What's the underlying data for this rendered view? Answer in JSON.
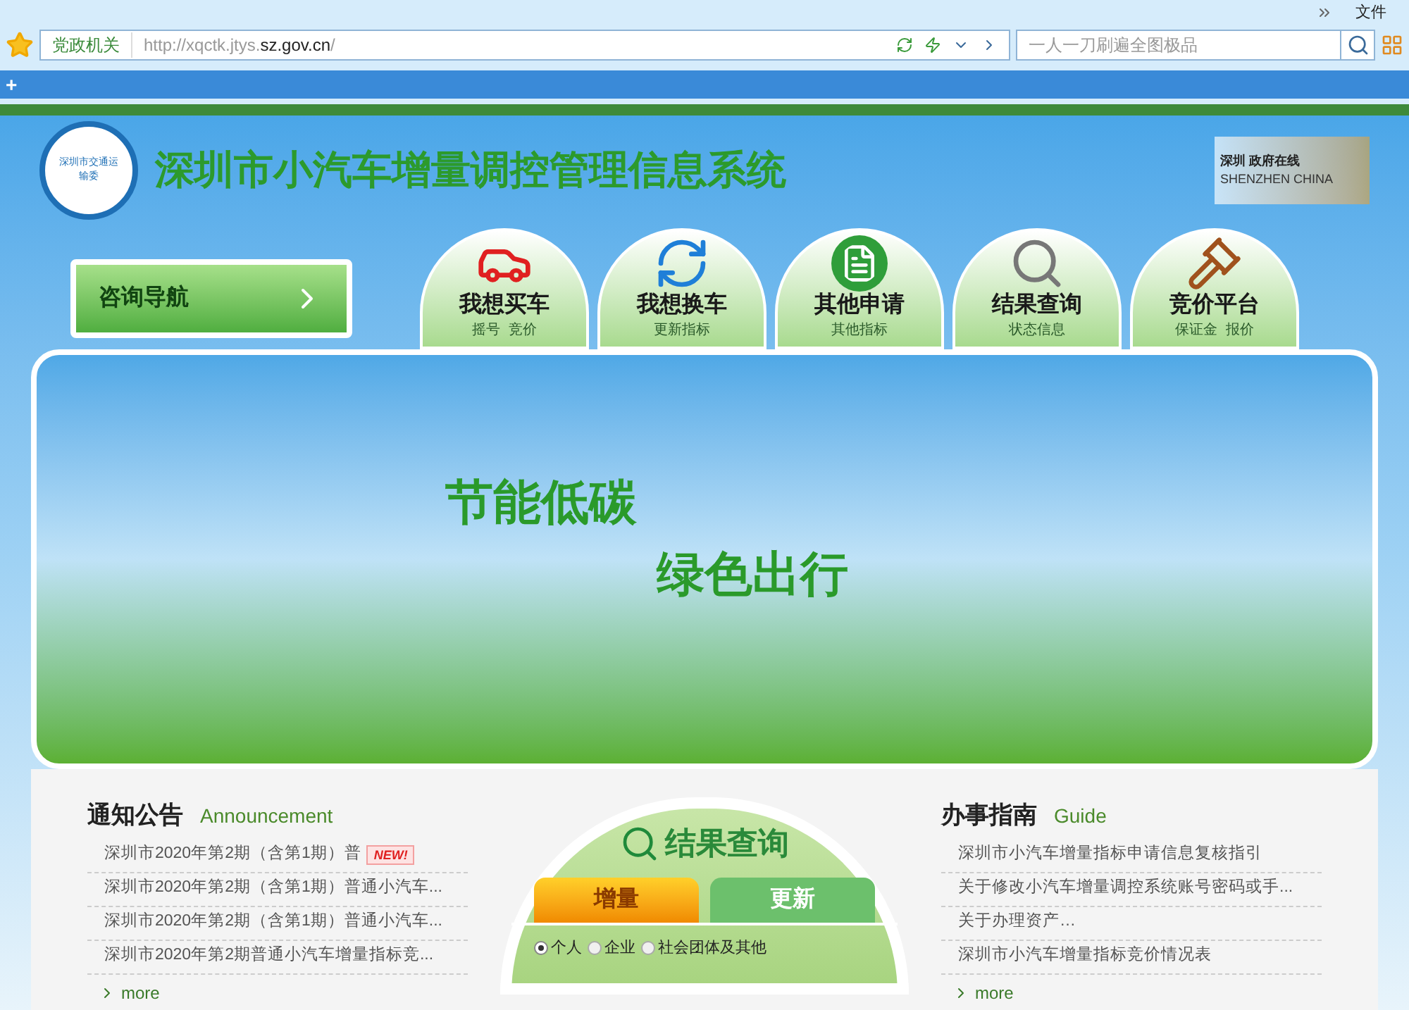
{
  "browser": {
    "menu": "文件",
    "address": {
      "badge": "党政机关",
      "url_prefix": "http://xqctk.jtys.",
      "url_domain": "sz.gov.cn",
      "url_suffix": "/"
    },
    "search": {
      "placeholder": "一人一刀刷遍全图极品"
    },
    "new_tab": "+"
  },
  "header": {
    "title": "深圳市小汽车增量调控管理信息系统",
    "logo_text": "深圳市交通运输委",
    "partner_top": "深圳 政府在线",
    "partner_bottom": "SHENZHEN CHINA"
  },
  "consult": {
    "label": "咨询导航"
  },
  "nav": [
    {
      "title": "我想买车",
      "sub": "摇号  竞价",
      "kind": "car"
    },
    {
      "title": "我想换车",
      "sub": "更新指标",
      "kind": "refresh"
    },
    {
      "title": "其他申请",
      "sub": "其他指标",
      "kind": "doc"
    },
    {
      "title": "结果查询",
      "sub": "状态信息",
      "kind": "search"
    },
    {
      "title": "竞价平台",
      "sub": "保证金  报价",
      "kind": "gavel"
    }
  ],
  "banner": {
    "slogan_1": "节能低碳",
    "slogan_2": "绿色出行"
  },
  "announcements": {
    "title": "通知公告",
    "subtitle": "Announcement",
    "items": [
      {
        "text": "深圳市2020年第2期（含第1期）普",
        "new": true,
        "badge": "NEW!"
      },
      {
        "text": "深圳市2020年第2期（含第1期）普通小汽车...",
        "new": false
      },
      {
        "text": "深圳市2020年第2期（含第1期）普通小汽车...",
        "new": false
      },
      {
        "text": "深圳市2020年第2期普通小汽车增量指标竞...",
        "new": false
      }
    ],
    "more": "more"
  },
  "query": {
    "title": "结果查询",
    "tabs": [
      {
        "label": "增量",
        "selected": true
      },
      {
        "label": "更新",
        "selected": false
      }
    ],
    "options": [
      {
        "label": "个人",
        "selected": true
      },
      {
        "label": "企业",
        "selected": false
      },
      {
        "label": "社会团体及其他",
        "selected": false
      }
    ]
  },
  "guide": {
    "title": "办事指南",
    "subtitle": "Guide",
    "items": [
      {
        "text": "深圳市小汽车增量指标申请信息复核指引"
      },
      {
        "text": "关于修改小汽车增量调控系统账号密码或手..."
      },
      {
        "text": "关于办理资产…"
      },
      {
        "text": "深圳市小汽车增量指标竞价情况表"
      }
    ],
    "more": "more"
  }
}
